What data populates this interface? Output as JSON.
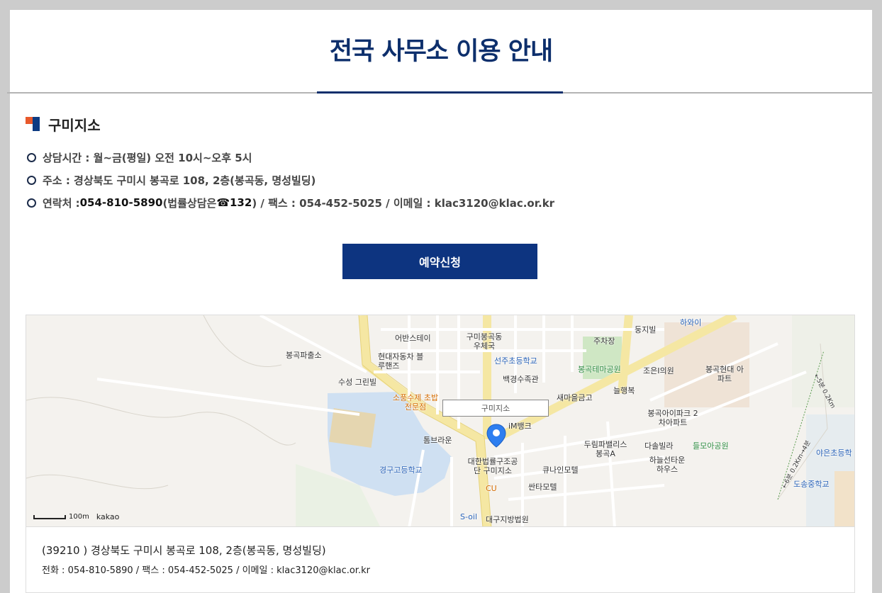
{
  "page_title": "전국 사무소 이용 안내",
  "branch": {
    "name": "구미지소",
    "hours": "상담시간 : 월~금(평일) 오전 10시~오후 5시",
    "address": "주소 : 경상북도 구미시 봉곡로 108, 2층(봉곡동, 명성빌딩)",
    "contact_prefix": "연락처 : ",
    "contact_phone": "054-810-5890",
    "contact_mid": " (법률상담은 ",
    "contact_hotline": "☎132",
    "contact_rest": ") / 팩스 : 054-452-5025 / 이메일 : klac3120@klac.or.kr"
  },
  "reserve_button": "예약신청",
  "map": {
    "marker_label": "구미지소",
    "scale": "100m",
    "brand": "kakao",
    "places": [
      "어반스테이",
      "구미봉곡동 우체국",
      "둥지빌",
      "하와이",
      "봉곡파출소",
      "현대자동차 블루핸즈",
      "선주초등학교",
      "주차장",
      "봉곡테마공원",
      "조은I의원",
      "봉곡현대 아파트",
      "수성 그린빌",
      "백경수족관",
      "소풍수제 초밥전문점",
      "새마을금고",
      "늘행복",
      "iM뱅크",
      "봉곡아이파크 2차아파트",
      "톰브라운",
      "두림파밸리스 봉곡A",
      "다솔빌라",
      "들모아공원",
      "경구고등학교",
      "대한법률구조공단 구미지소",
      "큐나인모텔",
      "하늘선타운 하우스",
      "야은초등학",
      "CU",
      "싼타모텔",
      "도송중학교",
      "S-oil",
      "대구지방법원",
      "←5분 0.2Km",
      "←6분 0.2Km→4분"
    ]
  },
  "footer_address": "(39210 ) 경상북도 구미시 봉곡로 108, 2층(봉곡동, 명성빌딩)",
  "footer_contact": "전화 : 054-810-5890 / 팩스 : 054-452-5025 / 이메일 : klac3120@klac.or.kr"
}
